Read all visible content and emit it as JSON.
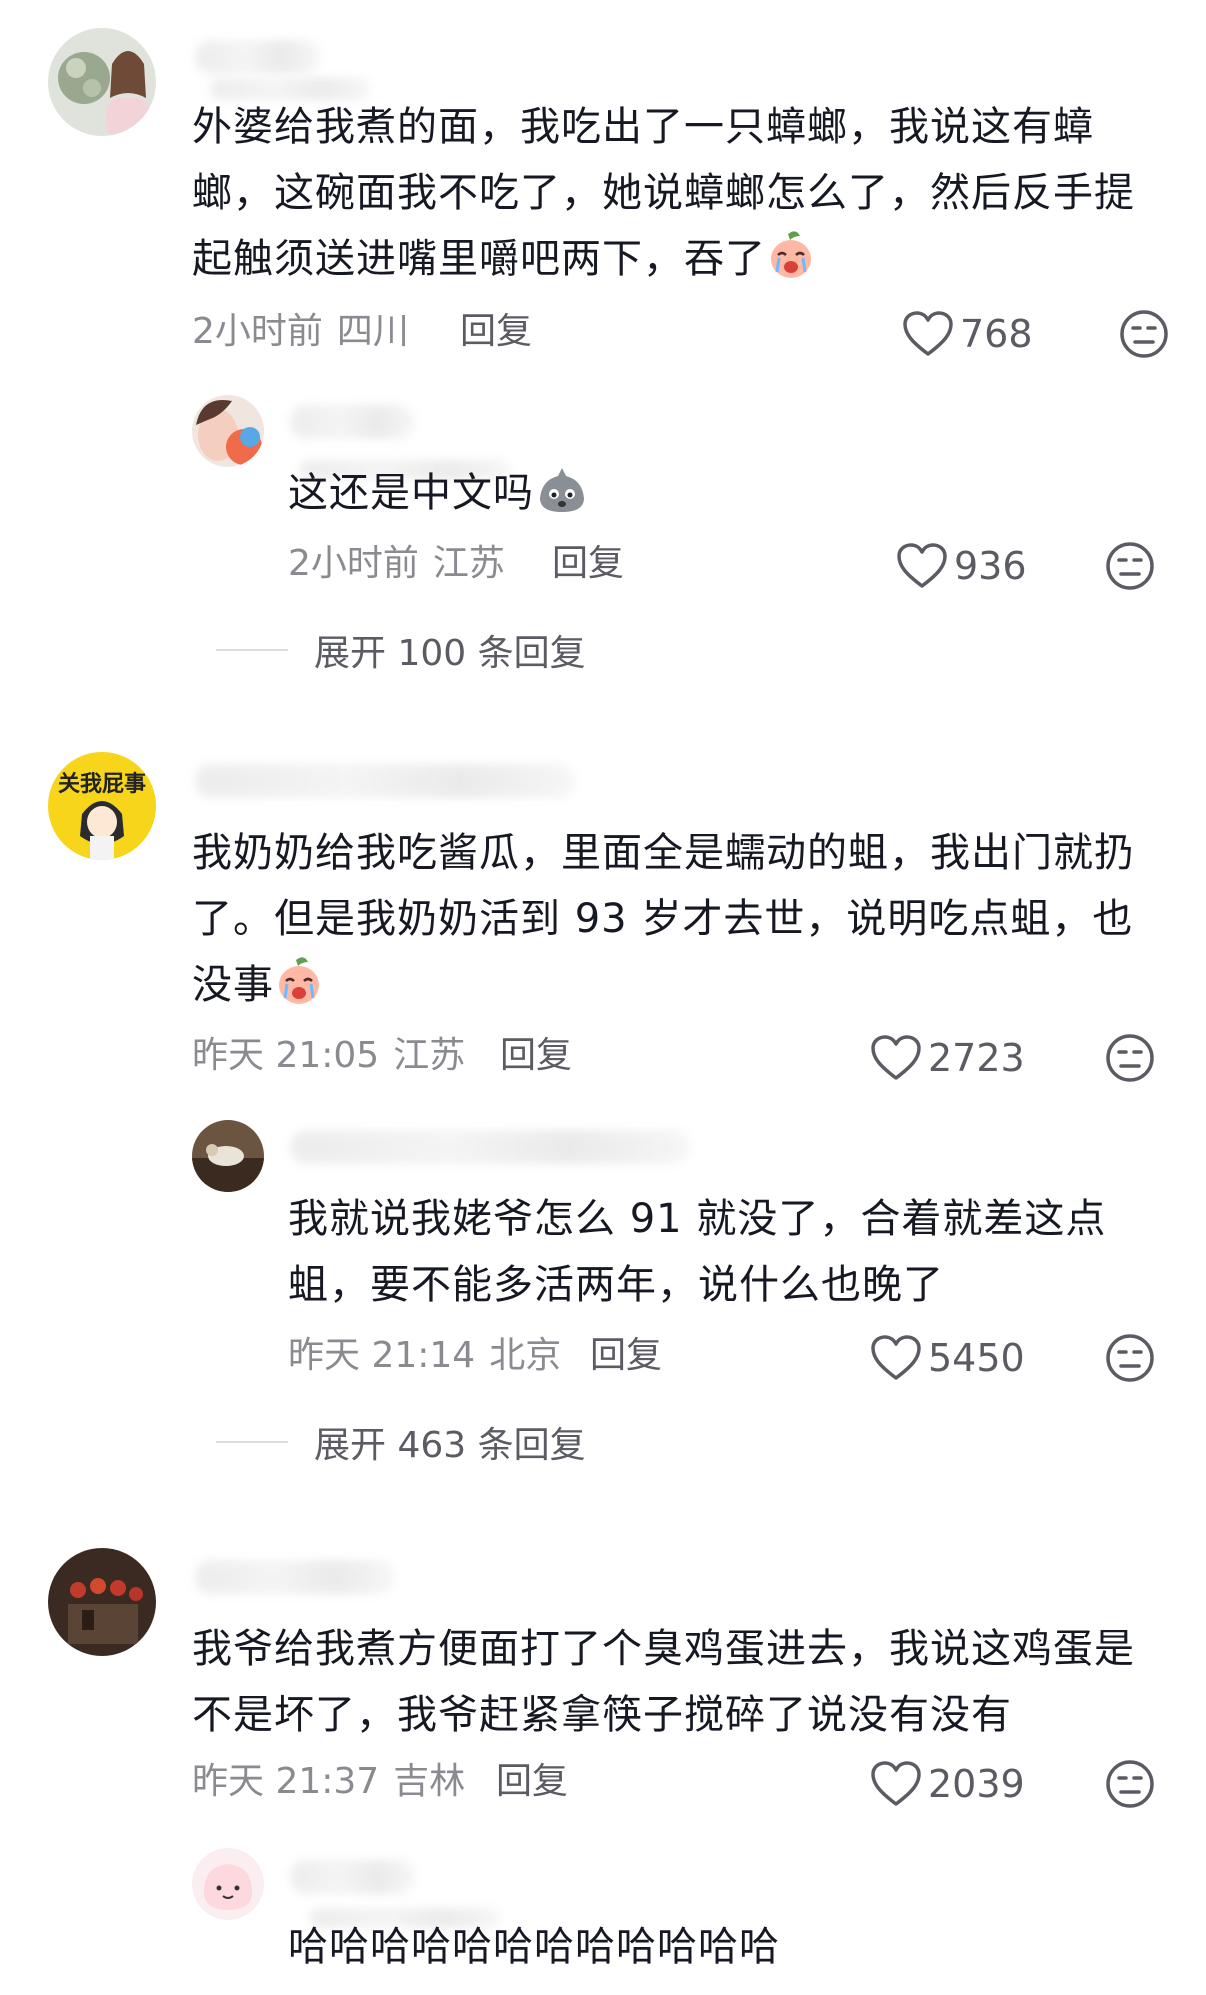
{
  "comments": [
    {
      "text": "外婆给我煮的面，我吃出了一只蟑螂，我说这有蟑螂，这碗面我不吃了，她说蟑螂怎么了，然后反手提起触须送进嘴里嚼吧两下，吞了",
      "time": "2小时前",
      "location": "四川",
      "reply_label": "回复",
      "likes": "768",
      "emoji_icon": "crying-face-sticker-icon",
      "replies": [
        {
          "text": "这还是中文吗",
          "time": "2小时前",
          "location": "江苏",
          "reply_label": "回复",
          "likes": "936",
          "emoji_icon": "gray-blob-sticker-icon"
        }
      ],
      "expand_label": "展开 100 条回复"
    },
    {
      "text": "我奶奶给我吃酱瓜，里面全是蠕动的蛆，我出门就扔了。但是我奶奶活到 93 岁才去世，说明吃点蛆，也没事",
      "time": "昨天 21:05",
      "location": "江苏",
      "reply_label": "回复",
      "likes": "2723",
      "emoji_icon": "crying-face-sticker-icon",
      "avatar_text": "关我屁事",
      "replies": [
        {
          "text": "我就说我姥爷怎么 91 就没了，合着就差这点蛆，要不能多活两年，说什么也晚了",
          "time": "昨天 21:14",
          "location": "北京",
          "reply_label": "回复",
          "likes": "5450"
        }
      ],
      "expand_label": "展开 463 条回复"
    },
    {
      "text": "我爷给我煮方便面打了个臭鸡蛋进去，我说这鸡蛋是不是坏了，我爷赶紧拿筷子搅碎了说没有没有",
      "time": "昨天 21:37",
      "location": "吉林",
      "reply_label": "回复",
      "likes": "2039",
      "replies": [
        {
          "text": "哈哈哈哈哈哈哈哈哈哈哈哈"
        }
      ]
    }
  ],
  "icons": {
    "like": "heart-outline-icon",
    "dislike": "neutral-face-icon"
  },
  "colors": {
    "text": "#161823",
    "meta": "#8a8b91",
    "action": "#5b5c63"
  }
}
